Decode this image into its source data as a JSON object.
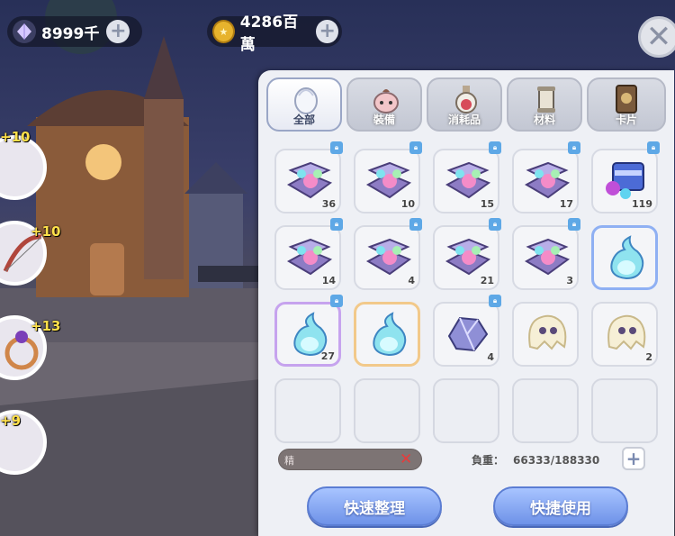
{
  "currency": {
    "crystal": {
      "icon": "crystal-icon",
      "value": "8999千"
    },
    "gold": {
      "icon": "gold-coin-icon",
      "value": "4286百萬"
    }
  },
  "side_items": [
    {
      "icon": "bow-icon",
      "level": "+10"
    },
    {
      "icon": "bow-icon",
      "level": "+10"
    },
    {
      "icon": "ring-icon",
      "level": "+13"
    },
    {
      "icon": "helmet-icon",
      "level": "+9"
    }
  ],
  "tabs": [
    {
      "label": "全部",
      "icon": "egg-icon",
      "active": true
    },
    {
      "label": "裝備",
      "icon": "poring-icon",
      "active": false
    },
    {
      "label": "消耗品",
      "icon": "potion-icon",
      "active": false
    },
    {
      "label": "材料",
      "icon": "scroll-icon",
      "active": false
    },
    {
      "label": "卡片",
      "icon": "card-icon",
      "active": false
    }
  ],
  "items": [
    {
      "icon": "chest-icon",
      "count": "36",
      "frame": "none",
      "locked": true
    },
    {
      "icon": "chest-icon",
      "count": "10",
      "frame": "none",
      "locked": true
    },
    {
      "icon": "chest-icon",
      "count": "15",
      "frame": "none",
      "locked": true
    },
    {
      "icon": "chest-icon",
      "count": "17",
      "frame": "none",
      "locked": true
    },
    {
      "icon": "gem-box-icon",
      "count": "119",
      "frame": "none",
      "locked": true
    },
    {
      "icon": "chest-icon",
      "count": "14",
      "frame": "none",
      "locked": true
    },
    {
      "icon": "chest-icon",
      "count": "4",
      "frame": "none",
      "locked": true
    },
    {
      "icon": "chest-icon",
      "count": "21",
      "frame": "none",
      "locked": true
    },
    {
      "icon": "chest-icon",
      "count": "3",
      "frame": "none",
      "locked": true
    },
    {
      "icon": "spirit-flame-icon",
      "count": "",
      "frame": "blue",
      "locked": false
    },
    {
      "icon": "spirit-flame-icon",
      "count": "27",
      "frame": "purple",
      "locked": true
    },
    {
      "icon": "spirit-flame-icon",
      "count": "",
      "frame": "orange",
      "locked": false
    },
    {
      "icon": "ore-icon",
      "count": "4",
      "frame": "none",
      "locked": true
    },
    {
      "icon": "ghost-cloth-icon",
      "count": "",
      "frame": "none",
      "locked": false
    },
    {
      "icon": "ghost-cloth-icon",
      "count": "2",
      "frame": "none",
      "locked": false
    },
    {
      "icon": "",
      "count": "",
      "frame": "empty",
      "locked": false
    },
    {
      "icon": "",
      "count": "",
      "frame": "empty",
      "locked": false
    },
    {
      "icon": "",
      "count": "",
      "frame": "empty",
      "locked": false
    },
    {
      "icon": "",
      "count": "",
      "frame": "empty",
      "locked": false
    },
    {
      "icon": "",
      "count": "",
      "frame": "empty",
      "locked": false
    }
  ],
  "search": {
    "placeholder": "精"
  },
  "weight": {
    "label": "負重：",
    "value": "66333/188330"
  },
  "buttons": {
    "sort": "快速整理",
    "use": "快捷使用"
  },
  "colors": {
    "accent_blue": "#6e92e8",
    "panel_bg": "#eef0f5",
    "lock_blue": "#5ea8e6"
  }
}
